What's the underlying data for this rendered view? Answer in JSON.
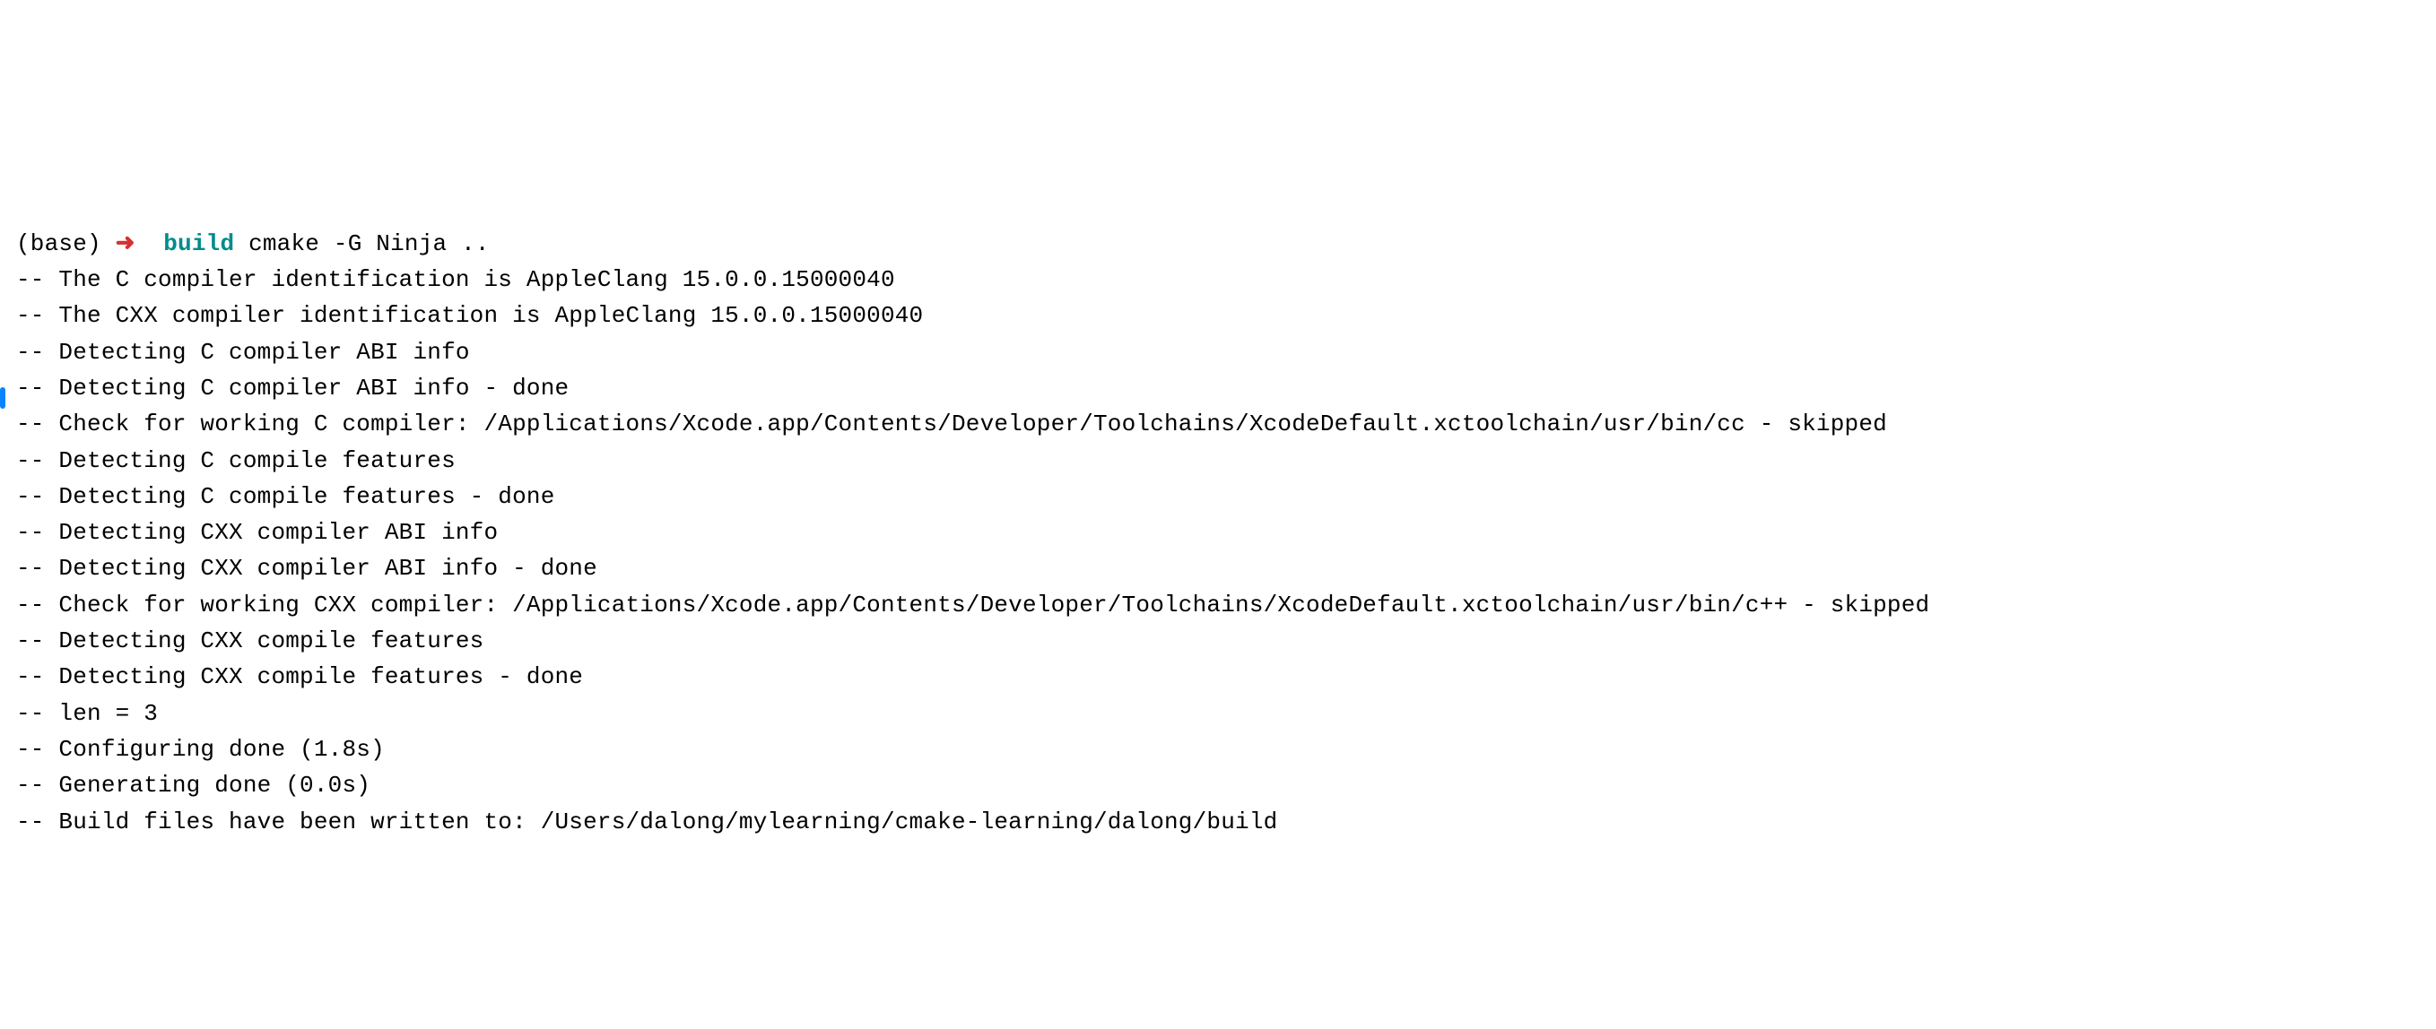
{
  "prompt": {
    "env": "(base)",
    "arrow": "➜",
    "dir": "build",
    "cmd": "cmake -G Ninja .."
  },
  "output": [
    "-- The C compiler identification is AppleClang 15.0.0.15000040",
    "-- The CXX compiler identification is AppleClang 15.0.0.15000040",
    "-- Detecting C compiler ABI info",
    "-- Detecting C compiler ABI info - done",
    "-- Check for working C compiler: /Applications/Xcode.app/Contents/Developer/Toolchains/XcodeDefault.xctoolchain/usr/bin/cc - skipped",
    "-- Detecting C compile features",
    "-- Detecting C compile features - done",
    "-- Detecting CXX compiler ABI info",
    "-- Detecting CXX compiler ABI info - done",
    "-- Check for working CXX compiler: /Applications/Xcode.app/Contents/Developer/Toolchains/XcodeDefault.xctoolchain/usr/bin/c++ - skipped",
    "-- Detecting CXX compile features",
    "-- Detecting CXX compile features - done",
    "-- len = 3",
    "-- Configuring done (1.8s)",
    "-- Generating done (0.0s)",
    "-- Build files have been written to: /Users/dalong/mylearning/cmake-learning/dalong/build"
  ]
}
